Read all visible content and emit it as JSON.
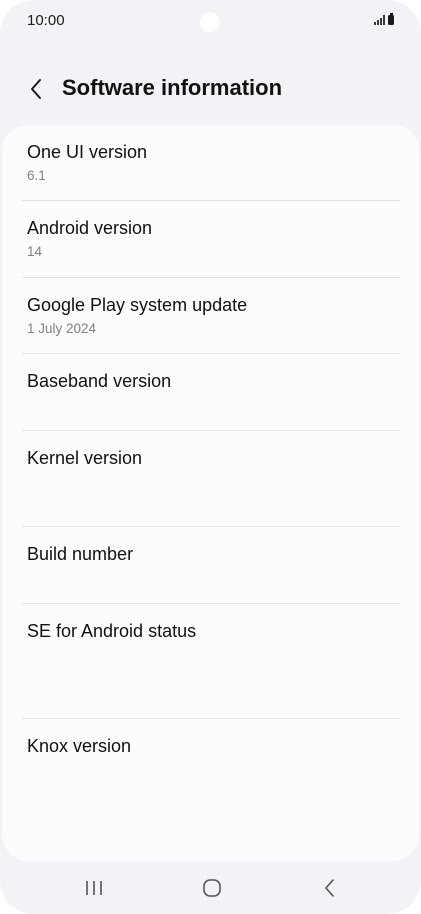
{
  "status_bar": {
    "time": "10:00"
  },
  "header": {
    "title": "Software information",
    "back_icon": "chevron-left-icon"
  },
  "items": [
    {
      "title": "One UI version",
      "value": "6.1"
    },
    {
      "title": "Android version",
      "value": "14"
    },
    {
      "title": "Google Play system update",
      "value": "1 July 2024"
    },
    {
      "title": "Baseband version",
      "value": ""
    },
    {
      "title": "Kernel version",
      "value": ""
    },
    {
      "title": "Build number",
      "value": ""
    },
    {
      "title": "SE for Android status",
      "value": ""
    },
    {
      "title": "Knox version",
      "value": ""
    }
  ],
  "nav_bar": {
    "recents_icon": "recents-icon",
    "home_icon": "home-icon",
    "back_icon": "back-icon"
  },
  "colors": {
    "background": "#f3f3f7",
    "card": "#fcfcfe",
    "text_primary": "#111111",
    "text_secondary": "#808085"
  }
}
